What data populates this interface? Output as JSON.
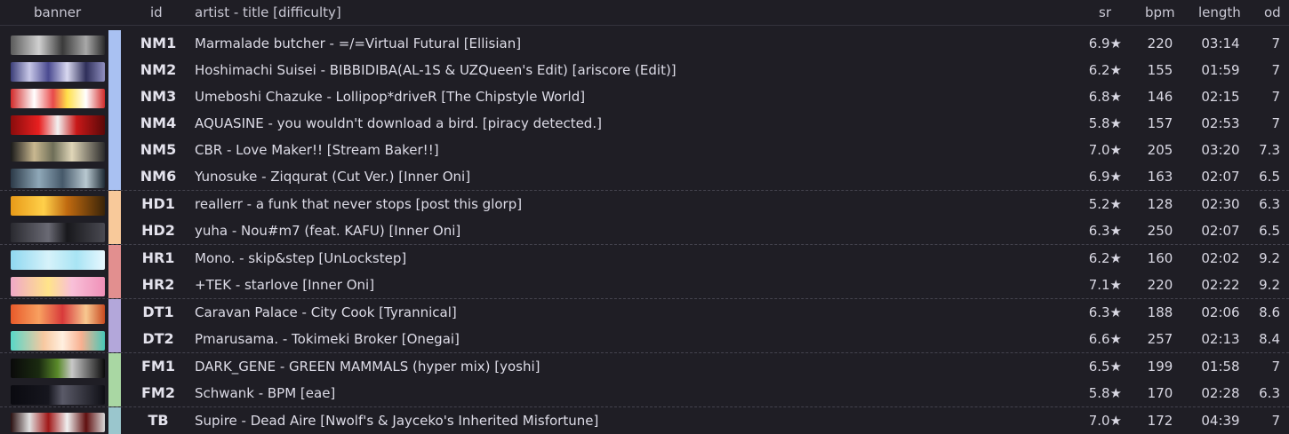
{
  "headers": {
    "banner": "banner",
    "id": "id",
    "title": "artist - title [difficulty]",
    "sr": "sr",
    "bpm": "bpm",
    "length": "length",
    "od": "od"
  },
  "colors": {
    "NM": "#a9c1f2",
    "HD": "#f8c99a",
    "HR": "#e28f8f",
    "DT": "#b3a7da",
    "FM": "#a9d7a3",
    "TB": "#9ac6cd"
  },
  "rows": [
    {
      "id": "NM1",
      "title": "Marmalade butcher - =/=Virtual Futural [Ellisian]",
      "sr": "6.9★",
      "bpm": "220",
      "length": "03:14",
      "od": "7",
      "mod": "NM",
      "banner": "linear-gradient(90deg,#5a5a5a,#d0d0d0 30%,#3a3a3a 55%,#a8a8a8 80%,#2a2a2a)"
    },
    {
      "id": "NM2",
      "title": "Hoshimachi Suisei - BIBBIDIBA(AL-1S & UZQueen's Edit) [ariscore (Edit)]",
      "sr": "6.2★",
      "bpm": "155",
      "length": "01:59",
      "od": "7",
      "mod": "NM",
      "banner": "linear-gradient(90deg,#3b3e78,#c8c8e8 20%,#4a4a90 40%,#d8d8f0 60%,#2f2f5a 80%,#9090c0)"
    },
    {
      "id": "NM3",
      "title": "Umeboshi Chazuke - Lollipop*driveR [The Chipstyle World]",
      "sr": "6.8★",
      "bpm": "146",
      "length": "02:15",
      "od": "7",
      "mod": "NM",
      "banner": "linear-gradient(90deg,#d12b2b,#ffffff 25%,#e84a4a 45%,#ffe04a 60%,#ffffff 80%,#d12b2b)"
    },
    {
      "id": "NM4",
      "title": "AQUASINE - you wouldn't download a bird. [piracy detected.]",
      "sr": "5.8★",
      "bpm": "157",
      "length": "02:53",
      "od": "7",
      "mod": "NM",
      "banner": "linear-gradient(90deg,#8a0c0c,#e82020 30%,#f2f2f2 50%,#c81818 70%,#5a0808)"
    },
    {
      "id": "NM5",
      "title": "CBR - Love Maker!! [Stream Baker!!]",
      "sr": "7.0★",
      "bpm": "205",
      "length": "03:20",
      "od": "7.3",
      "mod": "NM",
      "banner": "linear-gradient(90deg,#1a1a1a,#c9b890 25%,#6e6e58 45%,#e0d6b8 65%,#2a2a2a)"
    },
    {
      "id": "NM6",
      "title": "Yunosuke - Ziqqurat (Cut Ver.) [Inner Oni]",
      "sr": "6.9★",
      "bpm": "163",
      "length": "02:07",
      "od": "6.5",
      "mod": "NM",
      "banner": "linear-gradient(90deg,#2c3a48,#8fa8b8 30%,#46596a 55%,#b8c8d0 80%,#1e2a34)"
    },
    {
      "id": "HD1",
      "title": "reallerr - a funk that never stops [post this glorp]",
      "sr": "5.2★",
      "bpm": "128",
      "length": "02:30",
      "od": "6.3",
      "mod": "HD",
      "banner": "linear-gradient(90deg,#e89a18,#ffd04a 35%,#c06a10 60%,#3a2408)"
    },
    {
      "id": "HD2",
      "title": "yuha - Nou#m7 (feat. KAFU) [Inner Oni]",
      "sr": "6.3★",
      "bpm": "250",
      "length": "02:07",
      "od": "6.5",
      "mod": "HD",
      "banner": "linear-gradient(90deg,#2a2a30,#6a6a74 40%,#18181c 60%,#4a4a52)"
    },
    {
      "id": "HR1",
      "title": "Mono. - skip&step [UnLockstep]",
      "sr": "6.2★",
      "bpm": "160",
      "length": "02:02",
      "od": "9.2",
      "mod": "HR",
      "banner": "linear-gradient(90deg,#8fd8f0,#d6f2fa 40%,#a8e4f4 70%,#e8f8ff)"
    },
    {
      "id": "HR2",
      "title": "+TEK - starlove [Inner Oni]",
      "sr": "7.1★",
      "bpm": "220",
      "length": "02:22",
      "od": "9.2",
      "mod": "HR",
      "banner": "linear-gradient(90deg,#f0a8c8,#ffe48a 40%,#f8c0d8 65%,#f090b8)"
    },
    {
      "id": "DT1",
      "title": "Caravan Palace - City Cook [Tyrannical]",
      "sr": "6.3★",
      "bpm": "188",
      "length": "02:06",
      "od": "8.6",
      "mod": "DT",
      "banner": "linear-gradient(90deg,#e85a2a,#f8a060 30%,#d83a3a 55%,#f8c890 80%,#c84a20)"
    },
    {
      "id": "DT2",
      "title": "Pmarusama. - Tokimeki Broker [Onegai]",
      "sr": "6.6★",
      "bpm": "257",
      "length": "02:13",
      "od": "8.4",
      "mod": "DT",
      "banner": "linear-gradient(90deg,#58d8c8,#f8c8a0 35%,#fff0e0 55%,#f8b090 75%,#48c8b8)"
    },
    {
      "id": "FM1",
      "title": "DARK_GENE - GREEN MAMMALS (hyper mix) [yoshi]",
      "sr": "6.5★",
      "bpm": "199",
      "length": "01:58",
      "od": "7",
      "mod": "FM",
      "banner": "linear-gradient(90deg,#0a0a0a,#1a2a10 30%,#5a8a2a 50%,#c8c8c8 65%,#0a0a0a)"
    },
    {
      "id": "FM2",
      "title": "Schwank - BPM [eae]",
      "sr": "5.8★",
      "bpm": "170",
      "length": "02:28",
      "od": "6.3",
      "mod": "FM",
      "banner": "linear-gradient(90deg,#0a0a10,#16161e 40%,#5a5a68 55%,#0e0e14)"
    },
    {
      "id": "TB",
      "title": "Supire - Dead Aire [Nwolf's & Jayceko's Inherited Misfortune]",
      "sr": "7.0★",
      "bpm": "172",
      "length": "04:39",
      "od": "7",
      "mod": "TB",
      "banner": "linear-gradient(90deg,#2a1010,#e0e0e0 20%,#a01818 40%,#f0f0f0 60%,#601010 80%,#d8d8d8)"
    }
  ]
}
